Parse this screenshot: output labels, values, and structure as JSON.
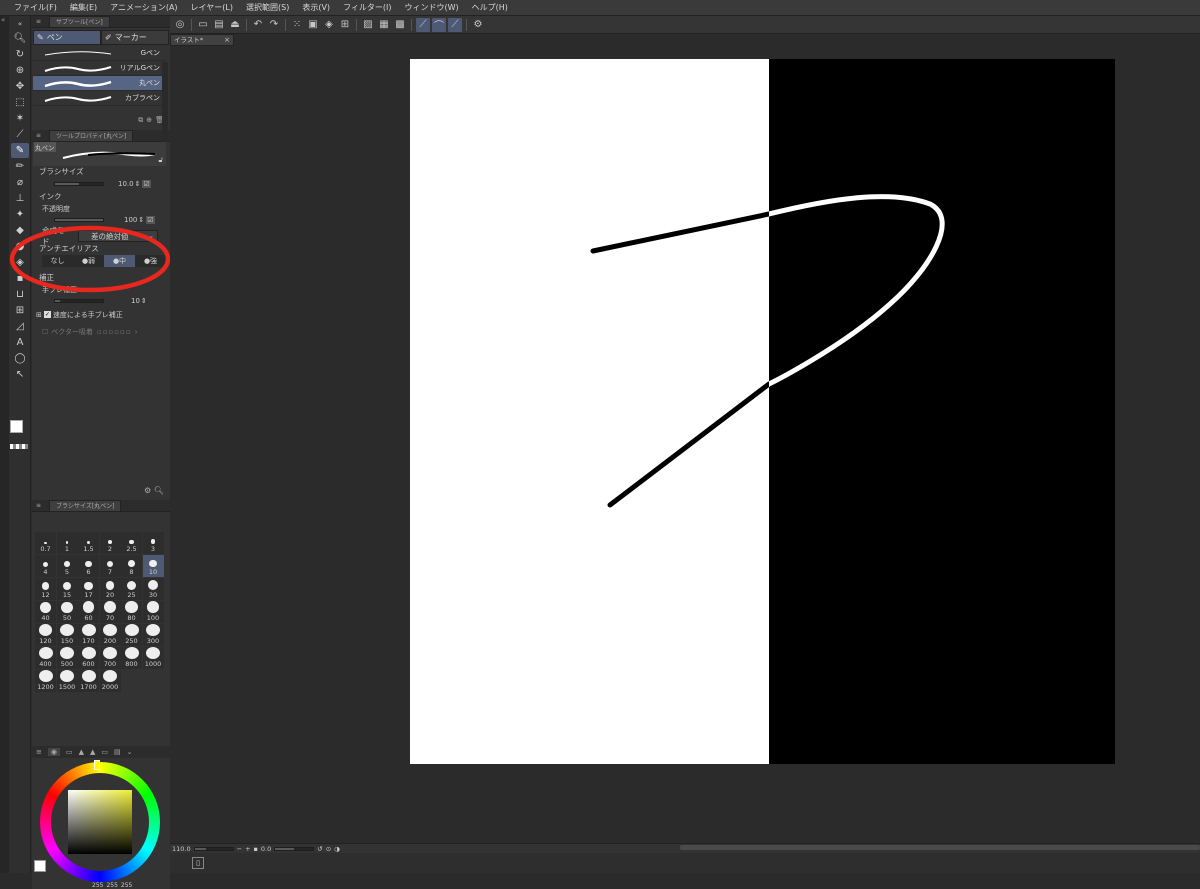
{
  "menu": [
    "ファイル(F)",
    "編集(E)",
    "アニメーション(A)",
    "レイヤー(L)",
    "選択範囲(S)",
    "表示(V)",
    "フィルター(I)",
    "ウィンドウ(W)",
    "ヘルプ(H)"
  ],
  "document_tab": {
    "title": "イラスト*",
    "close": "×"
  },
  "subtool_panel": {
    "header": "サブツール[ペン]",
    "tabs": [
      "ペン",
      "マーカー"
    ],
    "brushes": [
      {
        "label": "Gペン",
        "active": false
      },
      {
        "label": "リアルGペン",
        "active": false
      },
      {
        "label": "丸ペン",
        "active": true
      },
      {
        "label": "カブラペン",
        "active": false
      }
    ]
  },
  "tool_property": {
    "header": "ツールプロパティ[丸ペン]",
    "preview_label": "丸ペン",
    "brush_size_label": "ブラシサイズ",
    "brush_size_value": "10.0",
    "ink_label": "インク",
    "opacity_label": "不透明度",
    "opacity_value": "100",
    "blend_label": "合成モード",
    "blend_value": "差の絶対値",
    "antialias_label": "アンチエイリアス",
    "antialias_options": [
      "なし",
      "弱",
      "中",
      "強"
    ],
    "antialias_selected": "中",
    "correction_label": "補正",
    "stabilization_label": "手ブレ補正",
    "stabilization_value": "10",
    "speed_stabilization_label": "速度による手ブレ補正",
    "vector_snap_label": "ベクター吸着"
  },
  "brush_size_panel": {
    "header": "ブラシサイズ[丸ペン]",
    "sizes": [
      "0.7",
      "1",
      "1.5",
      "2",
      "2.5",
      "3",
      "4",
      "5",
      "6",
      "7",
      "8",
      "10",
      "12",
      "15",
      "17",
      "20",
      "25",
      "30",
      "40",
      "50",
      "60",
      "70",
      "80",
      "100",
      "120",
      "150",
      "170",
      "200",
      "250",
      "300",
      "400",
      "500",
      "600",
      "700",
      "800",
      "1000",
      "1200",
      "1500",
      "1700",
      "2000"
    ],
    "selected": "10"
  },
  "color_panel": {
    "values": [
      "255",
      "255",
      "255"
    ]
  },
  "status": {
    "zoom": "110.0",
    "rotation": "0.0"
  },
  "colors": {
    "accent": "#4e5a74",
    "highlight_circle": "#e8281e",
    "canvas_white": "#ffffff",
    "canvas_black": "#000000"
  }
}
